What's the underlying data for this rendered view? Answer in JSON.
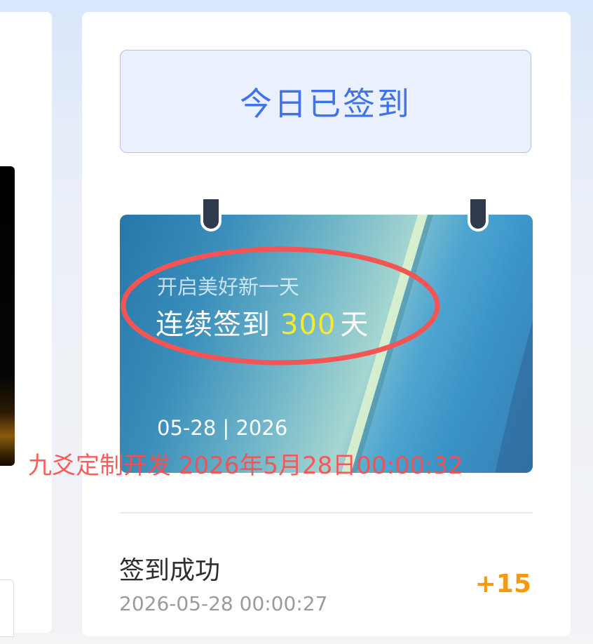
{
  "checkin": {
    "button_label": "今日已签到"
  },
  "calendar": {
    "subtitle": "开启美好新一天",
    "streak_prefix": "连续签到",
    "streak_days": "300",
    "streak_suffix": "天",
    "date": "05-28 | 2026"
  },
  "watermark": {
    "text": "九爻定制开发  2026年5月28日00:00:32"
  },
  "log": {
    "title": "签到成功",
    "time": "2026-05-28 00:00:27",
    "points": "+15"
  },
  "colors": {
    "accent_blue": "#3f73ea",
    "streak_yellow": "#f7ea2b",
    "points_orange": "#f39a12",
    "annotation_red": "#ff4b4b"
  }
}
